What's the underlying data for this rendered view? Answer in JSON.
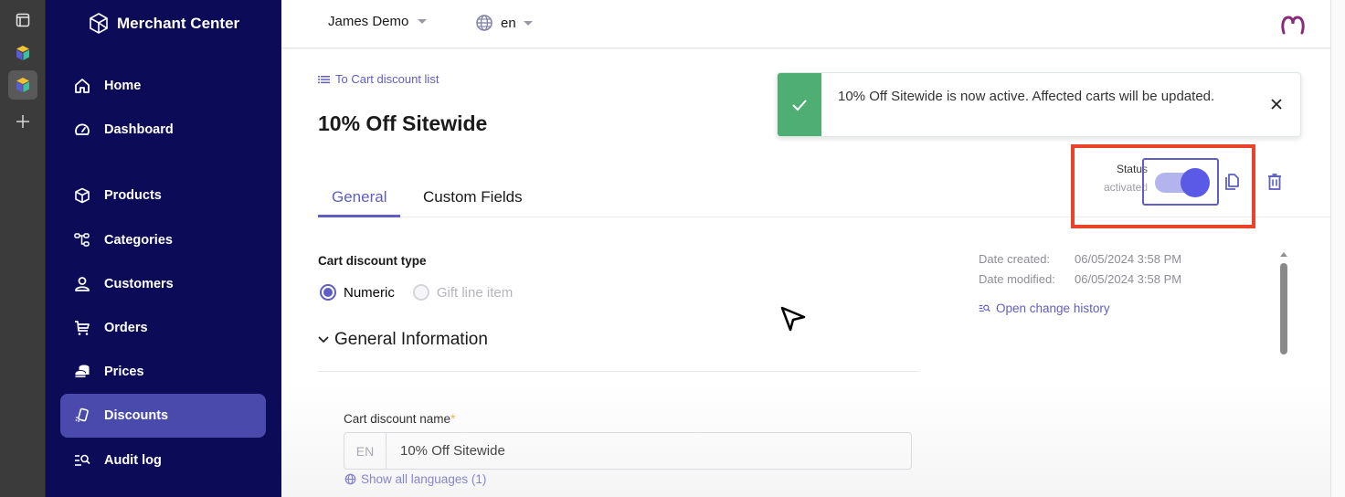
{
  "rail": {
    "items": [
      {
        "icon": "panel-icon"
      },
      {
        "icon": "app-cube-icon"
      },
      {
        "icon": "app-cube-icon",
        "active": true
      },
      {
        "icon": "plus-icon"
      }
    ]
  },
  "sidebar": {
    "brand": "Merchant Center",
    "items": [
      {
        "label": "Home",
        "icon": "home-icon"
      },
      {
        "label": "Dashboard",
        "icon": "gauge-icon"
      },
      {
        "label": "Products",
        "icon": "box-icon"
      },
      {
        "label": "Categories",
        "icon": "hierarchy-icon"
      },
      {
        "label": "Customers",
        "icon": "user-icon"
      },
      {
        "label": "Orders",
        "icon": "cart-icon"
      },
      {
        "label": "Prices",
        "icon": "coins-icon"
      },
      {
        "label": "Discounts",
        "icon": "discount-tag-icon",
        "active": true
      },
      {
        "label": "Audit log",
        "icon": "audit-search-icon"
      }
    ]
  },
  "topbar": {
    "project": "James Demo",
    "language": "en"
  },
  "page": {
    "back_link": "To Cart discount list",
    "title": "10% Off Sitewide",
    "tabs": [
      {
        "label": "General",
        "active": true
      },
      {
        "label": "Custom Fields",
        "active": false
      }
    ],
    "status": {
      "label": "Status",
      "value": "activated",
      "enabled": true
    },
    "discount_type": {
      "label": "Cart discount type",
      "options": [
        {
          "label": "Numeric",
          "selected": true,
          "disabled": false
        },
        {
          "label": "Gift line item",
          "selected": false,
          "disabled": true
        }
      ]
    },
    "section": {
      "title": "General Information",
      "expanded": true
    },
    "name_field": {
      "label": "Cart discount name",
      "required_marker": "*",
      "lang": "EN",
      "value": "10% Off Sitewide",
      "languages_link": "Show all languages (1)"
    },
    "meta": {
      "created_label": "Date created:",
      "created_value": "06/05/2024 3:58 PM",
      "modified_label": "Date modified:",
      "modified_value": "06/05/2024 3:58 PM",
      "history_link": "Open change history"
    }
  },
  "toast": {
    "message": "10% Off Sitewide is now active. Affected carts will be updated.",
    "type": "success",
    "color": "#4fae73"
  },
  "colors": {
    "sidebar_bg": "#0b0b57",
    "accent": "#5e5ec4",
    "active_nav": "#4a4aad",
    "highlight": "#e8432b"
  }
}
